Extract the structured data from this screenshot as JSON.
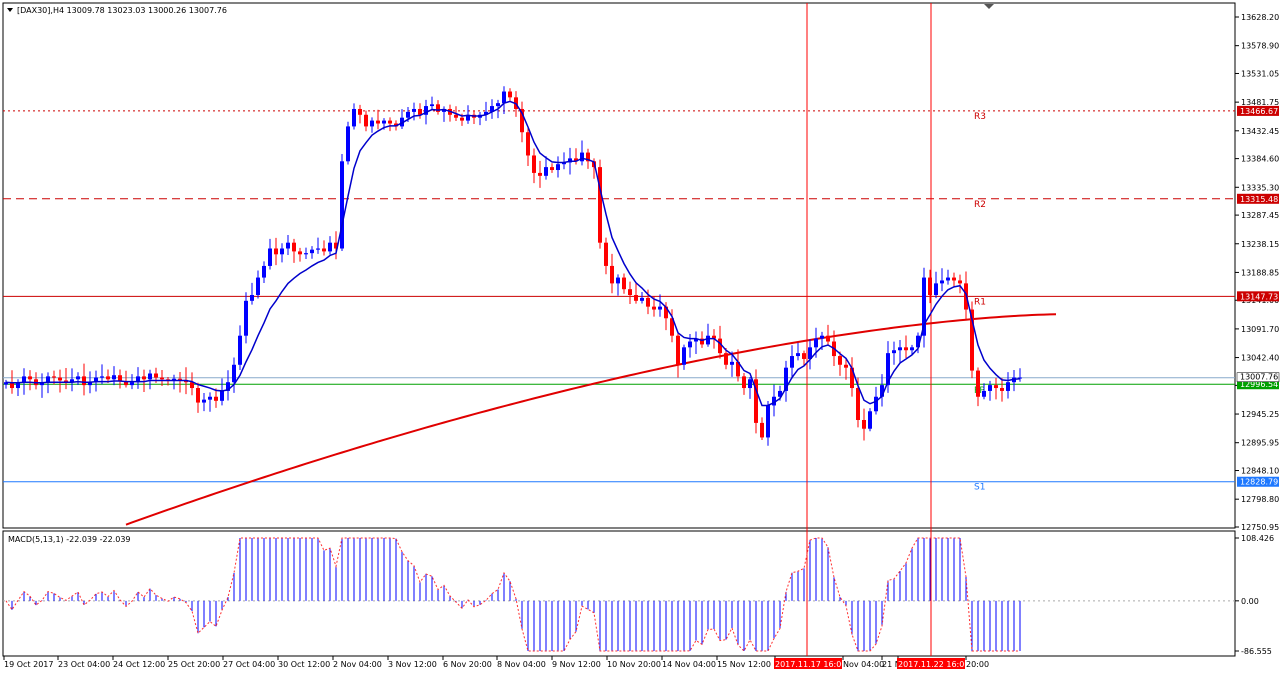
{
  "header": {
    "title": "[DAX30],H4  13009.78 13023.03 13000.26 13007.76"
  },
  "macd_label": "MACD(5,13,1) -22.039 -22.039",
  "colors": {
    "bull": "#0000ff",
    "bear": "#ff0000",
    "ma_fast": "#0000cc",
    "ma_slow": "#e00000",
    "pivot_green": "#00a000",
    "s1_blue": "#1e78ff",
    "resistance": "#cc0000"
  },
  "chart_data": {
    "type": "candlestick",
    "y_axis_ticks": [
      "13628.20",
      "13578.90",
      "13531.05",
      "13481.75",
      "13432.45",
      "13384.60",
      "13335.30",
      "13287.45",
      "13238.15",
      "13188.85",
      "13141.00",
      "13091.70",
      "13042.40",
      "12994.55",
      "12945.25",
      "12895.95",
      "12848.10",
      "12798.80",
      "12750.95"
    ],
    "ylim": [
      12745,
      13655
    ],
    "x_axis_labels": [
      "19 Oct 2017",
      "23 Oct 04:00",
      "24 Oct 12:00",
      "25 Oct 20:00",
      "27 Oct 04:00",
      "30 Oct 12:00",
      "2 Nov 04:00",
      "3 Nov 12:00",
      "6 Nov 20:00",
      "8 Nov 04:00",
      "9 Nov 12:00",
      "10 Nov 20:00",
      "14 Nov 04:00",
      "15 Nov 12:00",
      "2017.11.17 16:00",
      "Nov 04:00",
      "21 N",
      "2017.11.22 16:00",
      "20:00"
    ],
    "highlighted_x_labels": [
      "2017.11.17 16:00",
      "2017.11.22 16:00"
    ],
    "levels": [
      {
        "name": "R3",
        "value": 13466.67,
        "label": "13466.67",
        "style": "dotted",
        "color": "#cc0000"
      },
      {
        "name": "R2",
        "value": 13315.48,
        "label": "13315.48",
        "style": "dashed",
        "color": "#cc0000"
      },
      {
        "name": "R1",
        "value": 13147.73,
        "label": "13147.73",
        "style": "solid",
        "color": "#cc0000"
      },
      {
        "name": "PP",
        "value": 12996.54,
        "label": "12996.54",
        "style": "solid",
        "color": "#00a000"
      },
      {
        "name": "S1",
        "value": 12828.79,
        "label": "12828.79",
        "style": "solid",
        "color": "#1e78ff"
      }
    ],
    "current_price": {
      "value": 13007.76,
      "label": "13007.76"
    },
    "series": [
      {
        "name": "price",
        "close": [
          13000,
          12990,
          13000,
          13010,
          13005,
          12995,
          13000,
          13010,
          13008,
          13003,
          13000,
          13005,
          13010,
          12995,
          13000,
          13008,
          13010,
          13005,
          13012,
          13002,
          12995,
          13000,
          13010,
          13005,
          13015,
          13008,
          13005,
          13002,
          13006,
          13004,
          13000,
          12990,
          12965,
          12970,
          12975,
          12968,
          12985,
          13000,
          13030,
          13080,
          13140,
          13150,
          13180,
          13200,
          13230,
          13220,
          13230,
          13240,
          13225,
          13220,
          13222,
          13228,
          13230,
          13225,
          13240,
          13230,
          13380,
          13440,
          13470,
          13460,
          13440,
          13450,
          13445,
          13450,
          13445,
          13440,
          13455,
          13465,
          13470,
          13460,
          13475,
          13478,
          13465,
          13470,
          13460,
          13455,
          13450,
          13460,
          13455,
          13460,
          13465,
          13475,
          13480,
          13500,
          13490,
          13470,
          13430,
          13390,
          13360,
          13355,
          13370,
          13365,
          13375,
          13378,
          13385,
          13380,
          13395,
          13380,
          13370,
          13240,
          13200,
          13170,
          13180,
          13160,
          13150,
          13140,
          13145,
          13130,
          13125,
          13130,
          13110,
          13080,
          13030,
          13060,
          13070,
          13075,
          13065,
          13080,
          13075,
          13050,
          13030,
          13035,
          13010,
          12990,
          13005,
          12930,
          12905,
          12960,
          12975,
          12985,
          13025,
          13045,
          13050,
          13040,
          13060,
          13075,
          13080,
          13070,
          13045,
          13030,
          13025,
          12990,
          12935,
          12920,
          12950,
          12975,
          12995,
          13050,
          13055,
          13060,
          13055,
          13060,
          13080,
          13180,
          13150,
          13170,
          13175,
          13180,
          13175,
          13170,
          13125,
          13020,
          12975,
          12985,
          12995,
          12990,
          12985,
          13000,
          13008,
          13008
        ]
      },
      {
        "name": "ma_fast",
        "values": [
          13000,
          12999,
          12999,
          13000,
          13000,
          12999,
          12999,
          13000,
          13000,
          13000,
          13000,
          13000,
          13001,
          13000,
          13000,
          13001,
          13001,
          13001,
          13002,
          13002,
          13001,
          13001,
          13001,
          13001,
          13003,
          13003,
          13003,
          13003,
          13003,
          13003,
          13003,
          13001,
          12996,
          12993,
          12990,
          12986,
          12985,
          12987,
          12996,
          13012,
          13035,
          13056,
          13080,
          13102,
          13126,
          13140,
          13156,
          13170,
          13179,
          13187,
          13193,
          13200,
          13206,
          13210,
          13218,
          13222,
          13270,
          13320,
          13368,
          13398,
          13412,
          13425,
          13432,
          13438,
          13441,
          13441,
          13446,
          13452,
          13458,
          13459,
          13464,
          13469,
          13468,
          13469,
          13466,
          13462,
          13458,
          13459,
          13458,
          13458,
          13460,
          13465,
          13470,
          13480,
          13483,
          13479,
          13463,
          13439,
          13413,
          13394,
          13386,
          13379,
          13378,
          13378,
          13380,
          13380,
          13385,
          13383,
          13379,
          13333,
          13289,
          13249,
          13226,
          13204,
          13186,
          13171,
          13162,
          13151,
          13143,
          13139,
          13129,
          13113,
          13085,
          13077,
          13075,
          13075,
          13072,
          13075,
          13075,
          13067,
          13055,
          13048,
          13035,
          13020,
          13015,
          12987,
          12960,
          12960,
          12965,
          12972,
          12990,
          13008,
          13022,
          13028,
          13039,
          13051,
          13061,
          13064,
          13058,
          13049,
          13041,
          13024,
          12994,
          12969,
          12963,
          12967,
          12976,
          13001,
          13019,
          13033,
          13040,
          13047,
          13058,
          13099,
          13116,
          13134,
          13148,
          13159,
          13164,
          13166,
          13152,
          13108,
          13064,
          13038,
          13024,
          13013,
          13004,
          13003,
          13005,
          13006
        ]
      },
      {
        "name": "ma_slow",
        "start_value": 12755,
        "end_value": 13117
      }
    ],
    "macd": {
      "name": "MACD(5,13,1)",
      "value": -22.039,
      "ticks": [
        "108.426",
        "0.00",
        "-86.555"
      ],
      "ylim": [
        -86.555,
        108.426
      ]
    }
  }
}
